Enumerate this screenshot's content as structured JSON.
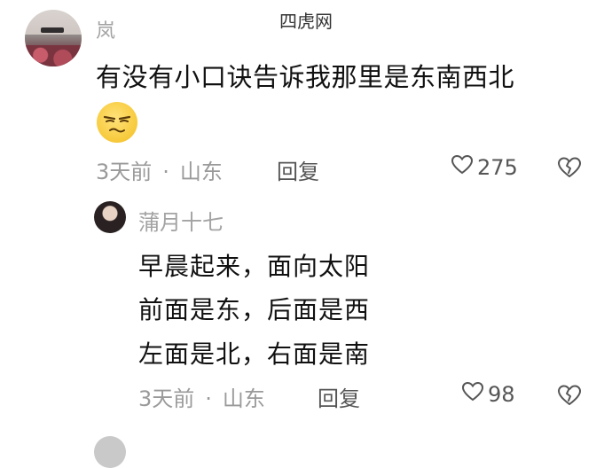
{
  "watermark": "四虎网",
  "comment": {
    "username": "岚",
    "text": "有没有小口诀告诉我那里是东南西北",
    "emoji_icon": "smirk-emoji-icon",
    "time": "3天前",
    "location": "山东",
    "reply_label": "回复",
    "likes": "275"
  },
  "reply": {
    "username": "蒲月十七",
    "lines": [
      "早晨起来，面向太阳",
      "前面是东，后面是西",
      "左面是北，右面是南"
    ],
    "time": "3天前",
    "location": "山东",
    "reply_label": "回复",
    "likes": "98"
  },
  "colors": {
    "meta_gray": "#9a9a9a",
    "text": "#111111",
    "emoji_yellow": "#f7c93a"
  }
}
